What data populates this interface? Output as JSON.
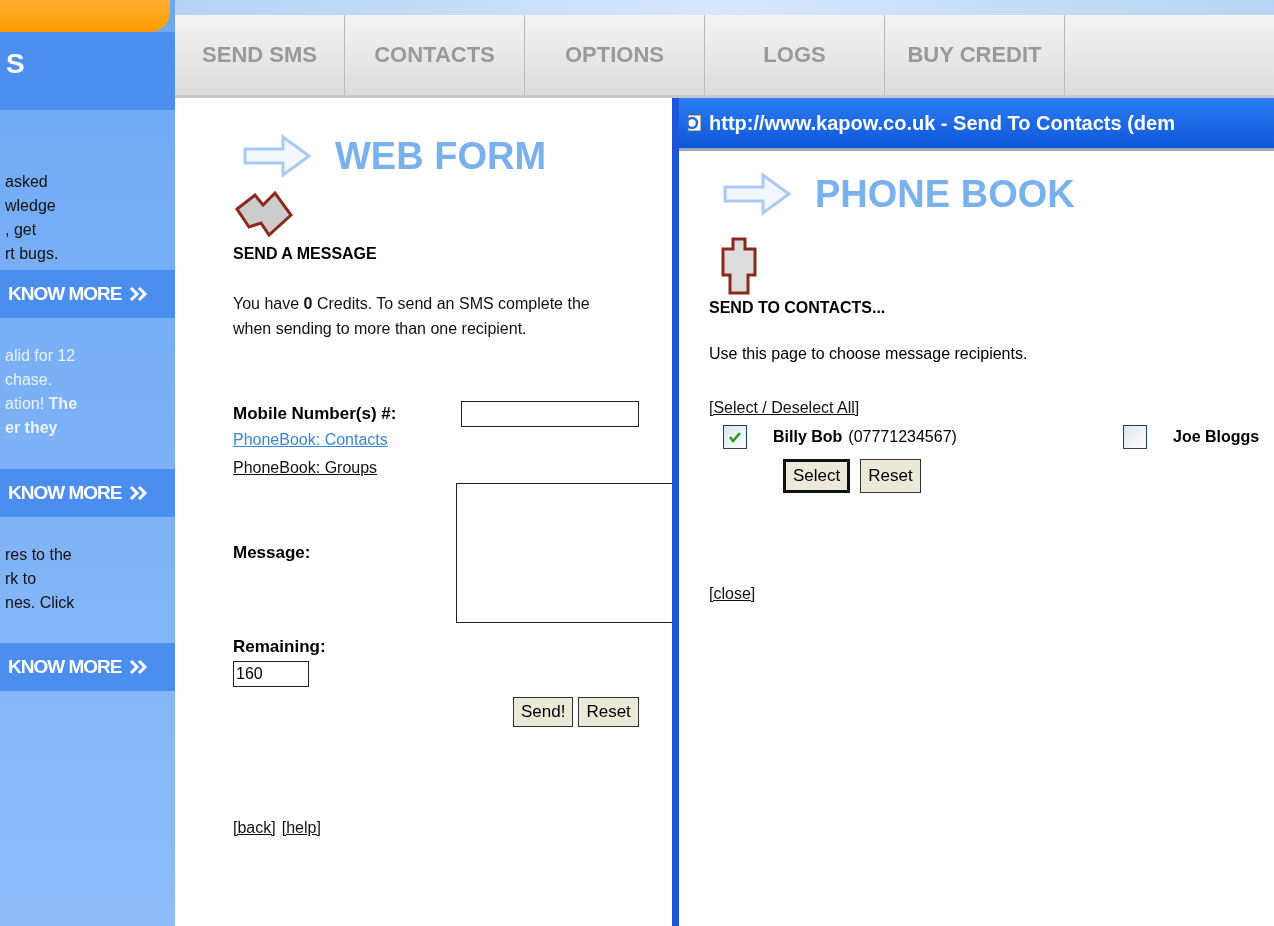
{
  "sidebar": {
    "title": "S",
    "blocks": [
      {
        "kind": "dark",
        "lines": [
          "asked",
          "wledge",
          ", get",
          "rt bugs."
        ],
        "button": "KNOW MORE"
      },
      {
        "kind": "light",
        "lines": [
          "alid for 12",
          "chase.",
          "ation! **The**",
          "**er they**"
        ],
        "button": "KNOW MORE"
      },
      {
        "kind": "dark",
        "lines": [
          "res to the",
          "rk to",
          "nes. Click"
        ],
        "button": "KNOW MORE"
      }
    ]
  },
  "nav": {
    "tabs": [
      {
        "label": "SEND SMS"
      },
      {
        "label": "CONTACTS"
      },
      {
        "label": "OPTIONS"
      },
      {
        "label": "LOGS"
      },
      {
        "label": "BUY CREDIT"
      }
    ]
  },
  "web_form": {
    "heading": "WEB FORM",
    "section_title": "SEND A MESSAGE",
    "intro_lines": [
      "You have **0** Credits. To send an SMS complete the",
      "when sending to more than one recipient."
    ],
    "mobile_label": "Mobile Number(s) #:",
    "contacts_link": "PhoneBook: Contacts",
    "groups_link": "PhoneBook: Groups",
    "message_label": "Message:",
    "remaining_label": "Remaining:",
    "remaining_value": "160",
    "buttons": [
      "Send!",
      "Reset"
    ],
    "footer_links": [
      "[back]",
      "[help]"
    ]
  },
  "popup": {
    "title": "http://www.kapow.co.uk - Send To Contacts (dem",
    "heading": "PHONE BOOK",
    "section_title": "SEND TO CONTACTS...",
    "intro": "Use this page to choose message recipients.",
    "select_all": "[Select / Deselect All]",
    "contacts": [
      {
        "name": "Billy Bob",
        "number": "(07771234567)",
        "checked": true
      },
      {
        "name": "Joe Bloggs",
        "checked": false
      }
    ],
    "buttons": [
      "Select",
      "Reset"
    ],
    "close": "[close]"
  }
}
